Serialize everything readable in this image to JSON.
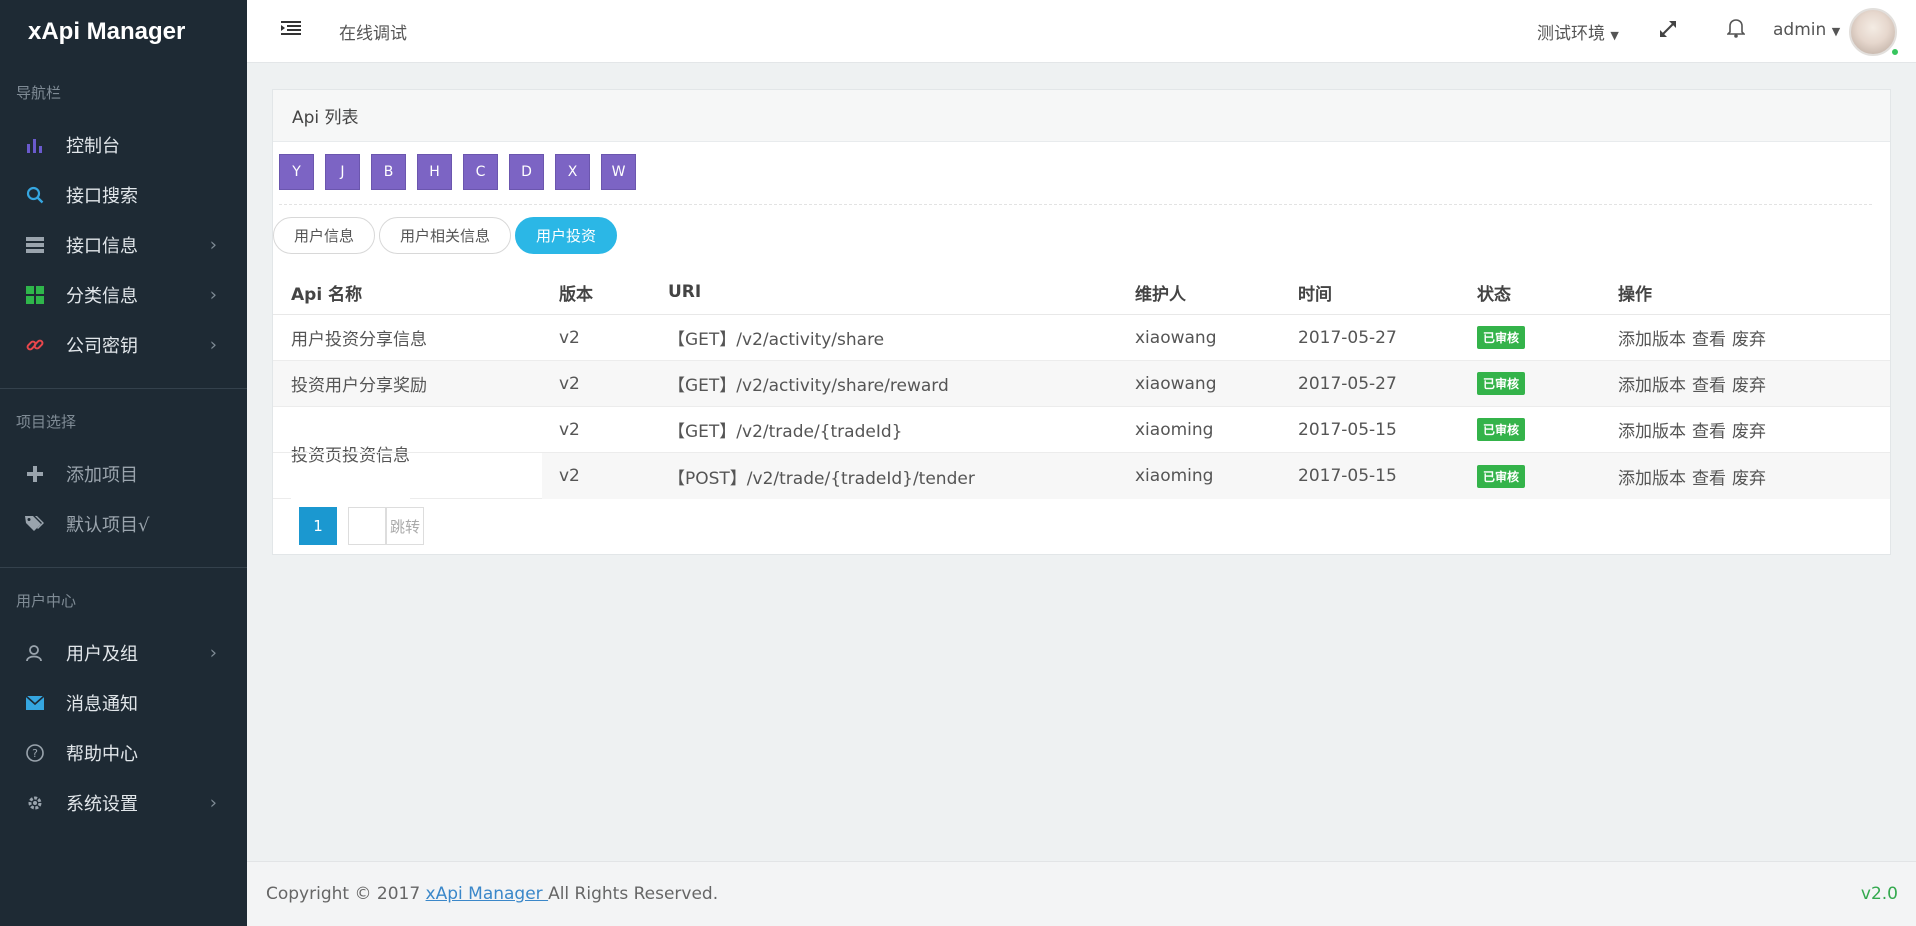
{
  "sidebar": {
    "brand": "xApi Manager",
    "sections": [
      {
        "label": "导航栏"
      },
      {
        "label": "项目选择"
      },
      {
        "label": "用户中心"
      }
    ],
    "nav": [
      {
        "label": "控制台",
        "icon": "bar-chart-icon"
      },
      {
        "label": "接口搜索",
        "icon": "search-icon"
      },
      {
        "label": "接口信息",
        "icon": "server-icon"
      },
      {
        "label": "分类信息",
        "icon": "grid-icon"
      },
      {
        "label": "公司密钥",
        "icon": "link-icon"
      }
    ],
    "projects": [
      {
        "label": "添加项目",
        "icon": "plus-icon"
      },
      {
        "label": "默认项目√",
        "icon": "tags-icon"
      }
    ],
    "user_center": [
      {
        "label": "用户及组",
        "icon": "user-icon"
      },
      {
        "label": "消息通知",
        "icon": "envelope-icon"
      },
      {
        "label": "帮助中心",
        "icon": "question-icon"
      },
      {
        "label": "系统设置",
        "icon": "gear-icon"
      }
    ]
  },
  "topbar": {
    "page_title": "在线调试",
    "env": "测试环境",
    "user": "admin"
  },
  "panel": {
    "title": "Api 列表",
    "letters": [
      "Y",
      "J",
      "B",
      "H",
      "C",
      "D",
      "X",
      "W"
    ],
    "tabs": [
      "用户信息",
      "用户相关信息",
      "用户投资"
    ],
    "active_tab": "用户投资"
  },
  "table": {
    "headers": [
      "Api 名称",
      "版本",
      "URI",
      "维护人",
      "时间",
      "状态",
      "操作"
    ],
    "rows": [
      {
        "name": "用户投资分享信息",
        "version": "v2",
        "uri": "【GET】/v2/activity/share",
        "owner": "xiaowang",
        "time": "2017-05-27",
        "status": "已审核"
      },
      {
        "name": "投资用户分享奖励",
        "version": "v2",
        "uri": "【GET】/v2/activity/share/reward",
        "owner": "xiaowang",
        "time": "2017-05-27",
        "status": "已审核"
      },
      {
        "name": "投资页投资信息",
        "version": "v2",
        "uri": "【GET】/v2/trade/{tradeId}",
        "owner": "xiaoming",
        "time": "2017-05-15",
        "status": "已审核"
      },
      {
        "name": "",
        "version": "v2",
        "uri": "【POST】/v2/trade/{tradeId}/tender",
        "owner": "xiaoming",
        "time": "2017-05-15",
        "status": "已审核"
      }
    ],
    "ops": [
      "添加版本",
      "查看",
      "废弃"
    ]
  },
  "pagination": {
    "current": "1",
    "jump_placeholder": "跳转"
  },
  "footer": {
    "copyright_prefix": "Copyright © 2017 ",
    "link": "xApi Manager ",
    "suffix": "All Rights Reserved.",
    "version": "v2.0"
  },
  "colors": {
    "sidebar_bg": "#1e2a34",
    "letter_btn": "#7c64c4",
    "active_tab": "#2bb7e6",
    "badge": "#34b34a",
    "page_active": "#1b98d0"
  }
}
